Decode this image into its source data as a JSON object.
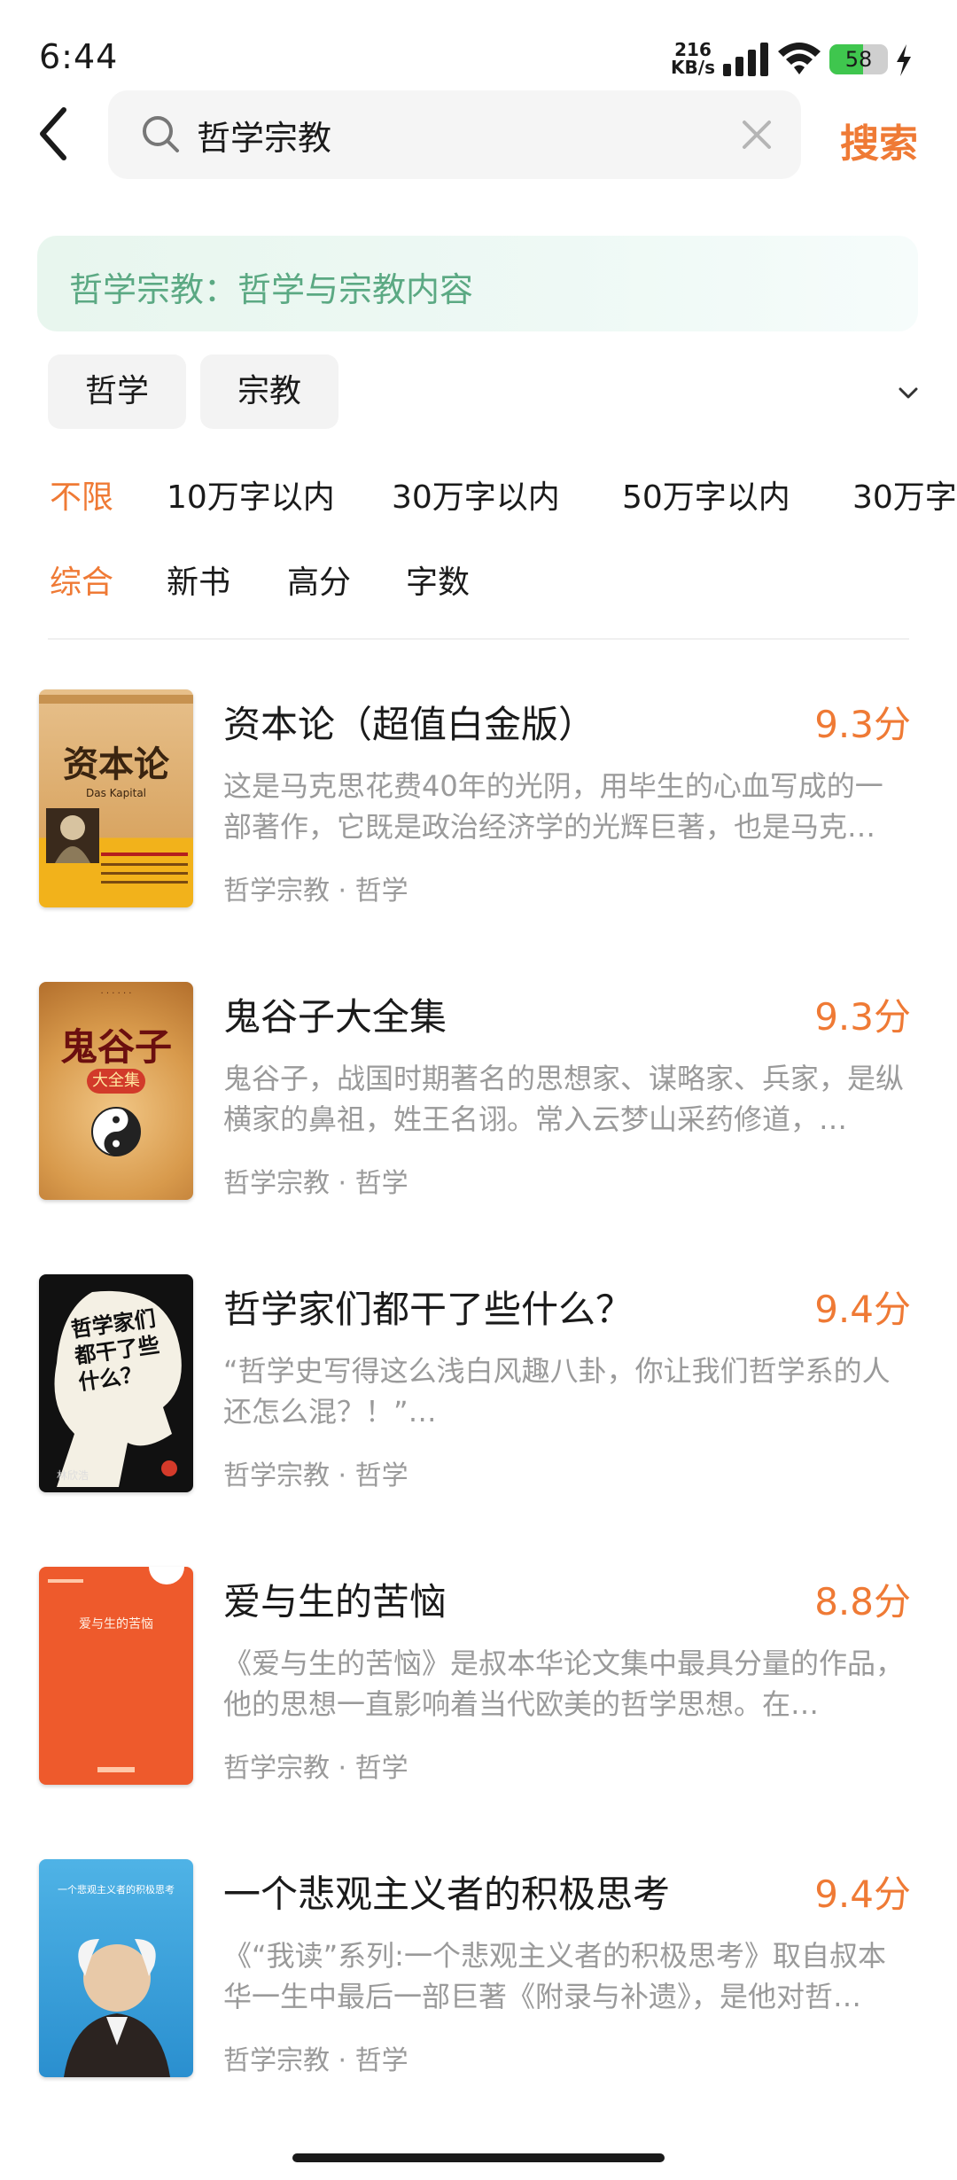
{
  "status_bar": {
    "time": "6:44",
    "net_speed_value": "216",
    "net_speed_unit": "KB/s",
    "battery_level": "58",
    "battery_fraction": 0.58,
    "icons": [
      "signal-icon",
      "wifi-icon",
      "battery-icon",
      "charging-bolt-icon"
    ]
  },
  "header": {
    "back_icon": "chevron-left-icon",
    "search_value": "哲学宗教",
    "search_icon": "search-icon",
    "clear_icon": "close-icon",
    "search_button": "搜索"
  },
  "banner": {
    "text": "哲学宗教：哲学与宗教内容"
  },
  "categories": [
    "哲学",
    "宗教"
  ],
  "word_count_filters": [
    "不限",
    "10万字以内",
    "30万字以内",
    "50万字以内",
    "30万字"
  ],
  "word_count_active": "不限",
  "sort_options": [
    "综合",
    "新书",
    "高分",
    "字数"
  ],
  "sort_active": "综合",
  "books": [
    {
      "title": "资本论（超值白金版）",
      "score": "9.3分",
      "description": "这是马克思花费40年的光阴，用毕生的心血写成的一部著作，它既是政治经济学的光辉巨著，也是马克…",
      "tags": "哲学宗教 · 哲学",
      "cover_text": "资本论",
      "cover_subtext": "Das Kapital"
    },
    {
      "title": "鬼谷子大全集",
      "score": "9.3分",
      "description": "鬼谷子，战国时期著名的思想家、谋略家、兵家，是纵横家的鼻祖，姓王名诩。常入云梦山采药修道，…",
      "tags": "哲学宗教 · 哲学",
      "cover_text": "鬼谷子",
      "cover_subtext": "大全集"
    },
    {
      "title": "哲学家们都干了些什么？",
      "score": "9.4分",
      "description": "“哲学史写得这么浅白风趣八卦，你让我们哲学系的人还怎么混？！”…",
      "tags": "哲学宗教 · 哲学",
      "cover_text": "哲学家们都干了些什么？",
      "cover_subtext": "林欣浩"
    },
    {
      "title": "爱与生的苦恼",
      "score": "8.8分",
      "description": "《爱与生的苦恼》是叔本华论文集中最具分量的作品，他的思想一直影响着当代欧美的哲学思想。在…",
      "tags": "哲学宗教 · 哲学",
      "cover_text": "爱与生的苦恼",
      "cover_subtext": ""
    },
    {
      "title": "一个悲观主义者的积极思考",
      "score": "9.4分",
      "description": "《“我读”系列:一个悲观主义者的积极思考》取自叔本华一生中最后一部巨著《附录与补遗》，是他对哲…",
      "tags": "哲学宗教 · 哲学",
      "cover_text": "一个悲观主义者的积极思考",
      "cover_subtext": ""
    }
  ],
  "colors": {
    "accent": "#ef7a35",
    "banner_text": "#5ba983",
    "muted": "#9a9a9a"
  }
}
